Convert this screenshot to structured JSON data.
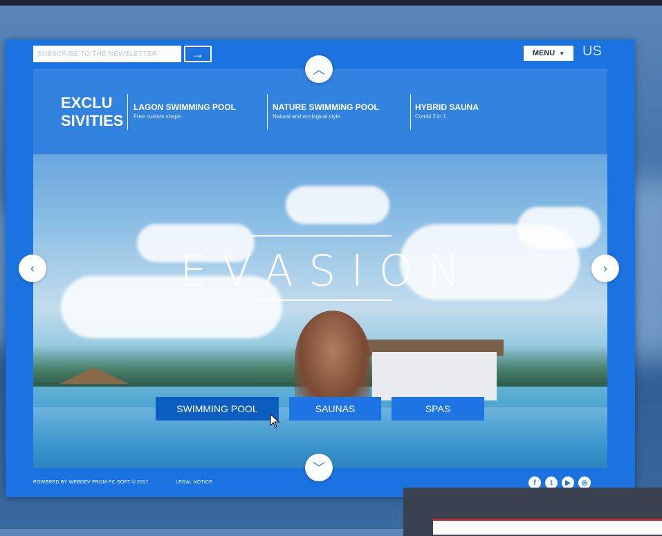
{
  "header": {
    "newsletter_placeholder": "SUBSCRIBE TO THE NEWSLETTER",
    "submit_icon": "arrow-right-icon",
    "menu_label": "MENU",
    "language": "US"
  },
  "brand": {
    "line1": "EXCLU",
    "line2": "SIVITIES"
  },
  "exclusivities": [
    {
      "title": "LAGON SWIMMING POOL",
      "subtitle": "Free custom shape"
    },
    {
      "title": "NATURE SWIMMING POOL",
      "subtitle": "Natural and ecological style"
    },
    {
      "title": "HYBRID SAUNA",
      "subtitle": "Combi 2 in 1"
    }
  ],
  "hero": {
    "title": "EVASION"
  },
  "categories": [
    {
      "label": "SWIMMING POOL",
      "active": true
    },
    {
      "label": "SAUNAS",
      "active": false
    },
    {
      "label": "SPAS",
      "active": false
    }
  ],
  "footer": {
    "powered": "POWERED BY WEBDEV FROM PC SOFT © 2017",
    "legal": "LEGAL NOTICE",
    "social_icons": [
      "facebook-icon",
      "twitter-icon",
      "youtube-icon",
      "instagram-icon"
    ]
  },
  "colors": {
    "accent": "#1a73e0",
    "active_button": "#0b5dbf"
  }
}
